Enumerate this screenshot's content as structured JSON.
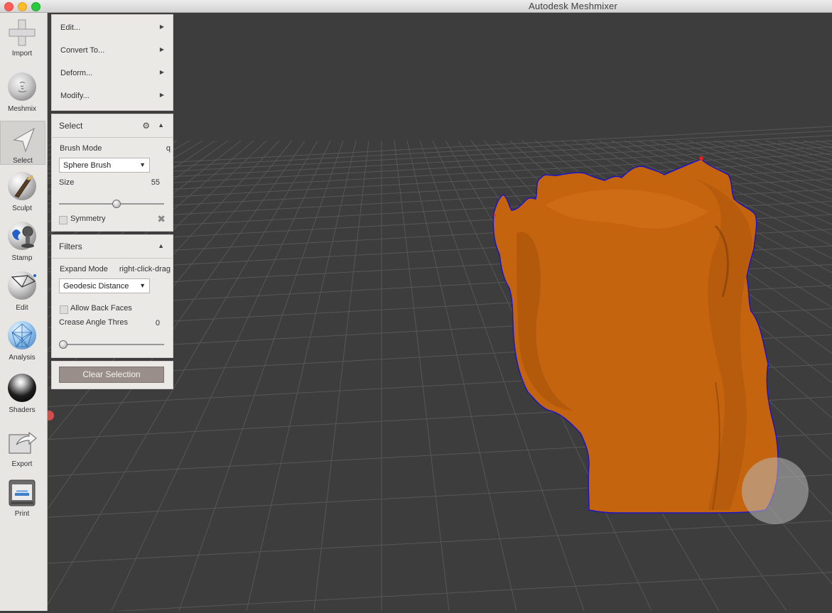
{
  "window": {
    "title": "Autodesk Meshmixer"
  },
  "toolbar": {
    "items": [
      {
        "label": "Import",
        "icon": "plus-icon"
      },
      {
        "label": "Meshmix",
        "icon": "meshmix-head-icon"
      },
      {
        "label": "Select",
        "icon": "select-arrow-icon",
        "active": true
      },
      {
        "label": "Sculpt",
        "icon": "sculpt-brush-icon"
      },
      {
        "label": "Stamp",
        "icon": "stamp-icon"
      },
      {
        "label": "Edit",
        "icon": "edit-sphere-icon"
      },
      {
        "label": "Analysis",
        "icon": "analysis-mesh-icon"
      },
      {
        "label": "Shaders",
        "icon": "shader-sphere-icon"
      },
      {
        "label": "Export",
        "icon": "export-icon"
      },
      {
        "label": "Print",
        "icon": "printer-icon"
      }
    ]
  },
  "action_menu": {
    "items": [
      {
        "label": "Edit..."
      },
      {
        "label": "Convert To..."
      },
      {
        "label": "Deform..."
      },
      {
        "label": "Modify..."
      }
    ]
  },
  "select_panel": {
    "title": "Select",
    "brush_mode_label": "Brush Mode",
    "brush_mode_hotkey": "q",
    "brush_value": "Sphere Brush",
    "size_label": "Size",
    "size_value": "55",
    "size_fraction": 0.55,
    "symmetry_label": "Symmetry",
    "symmetry_checked": false
  },
  "filters_panel": {
    "title": "Filters",
    "expand_mode_label": "Expand Mode",
    "expand_mode_hint": "right-click-drag",
    "expand_value": "Geodesic Distance",
    "allow_back_faces_label": "Allow Back Faces",
    "allow_back_faces_checked": false,
    "crease_label": "Crease Angle Thres",
    "crease_value": "0",
    "crease_fraction": 0.0
  },
  "clear_selection_label": "Clear Selection",
  "colors": {
    "mesh": "#c4640f",
    "mesh_outline": "#1c14c8",
    "viewport_bg": "#3d3d3d",
    "grid": "#5a5a5a",
    "panel_bg": "#ebe9e6"
  }
}
